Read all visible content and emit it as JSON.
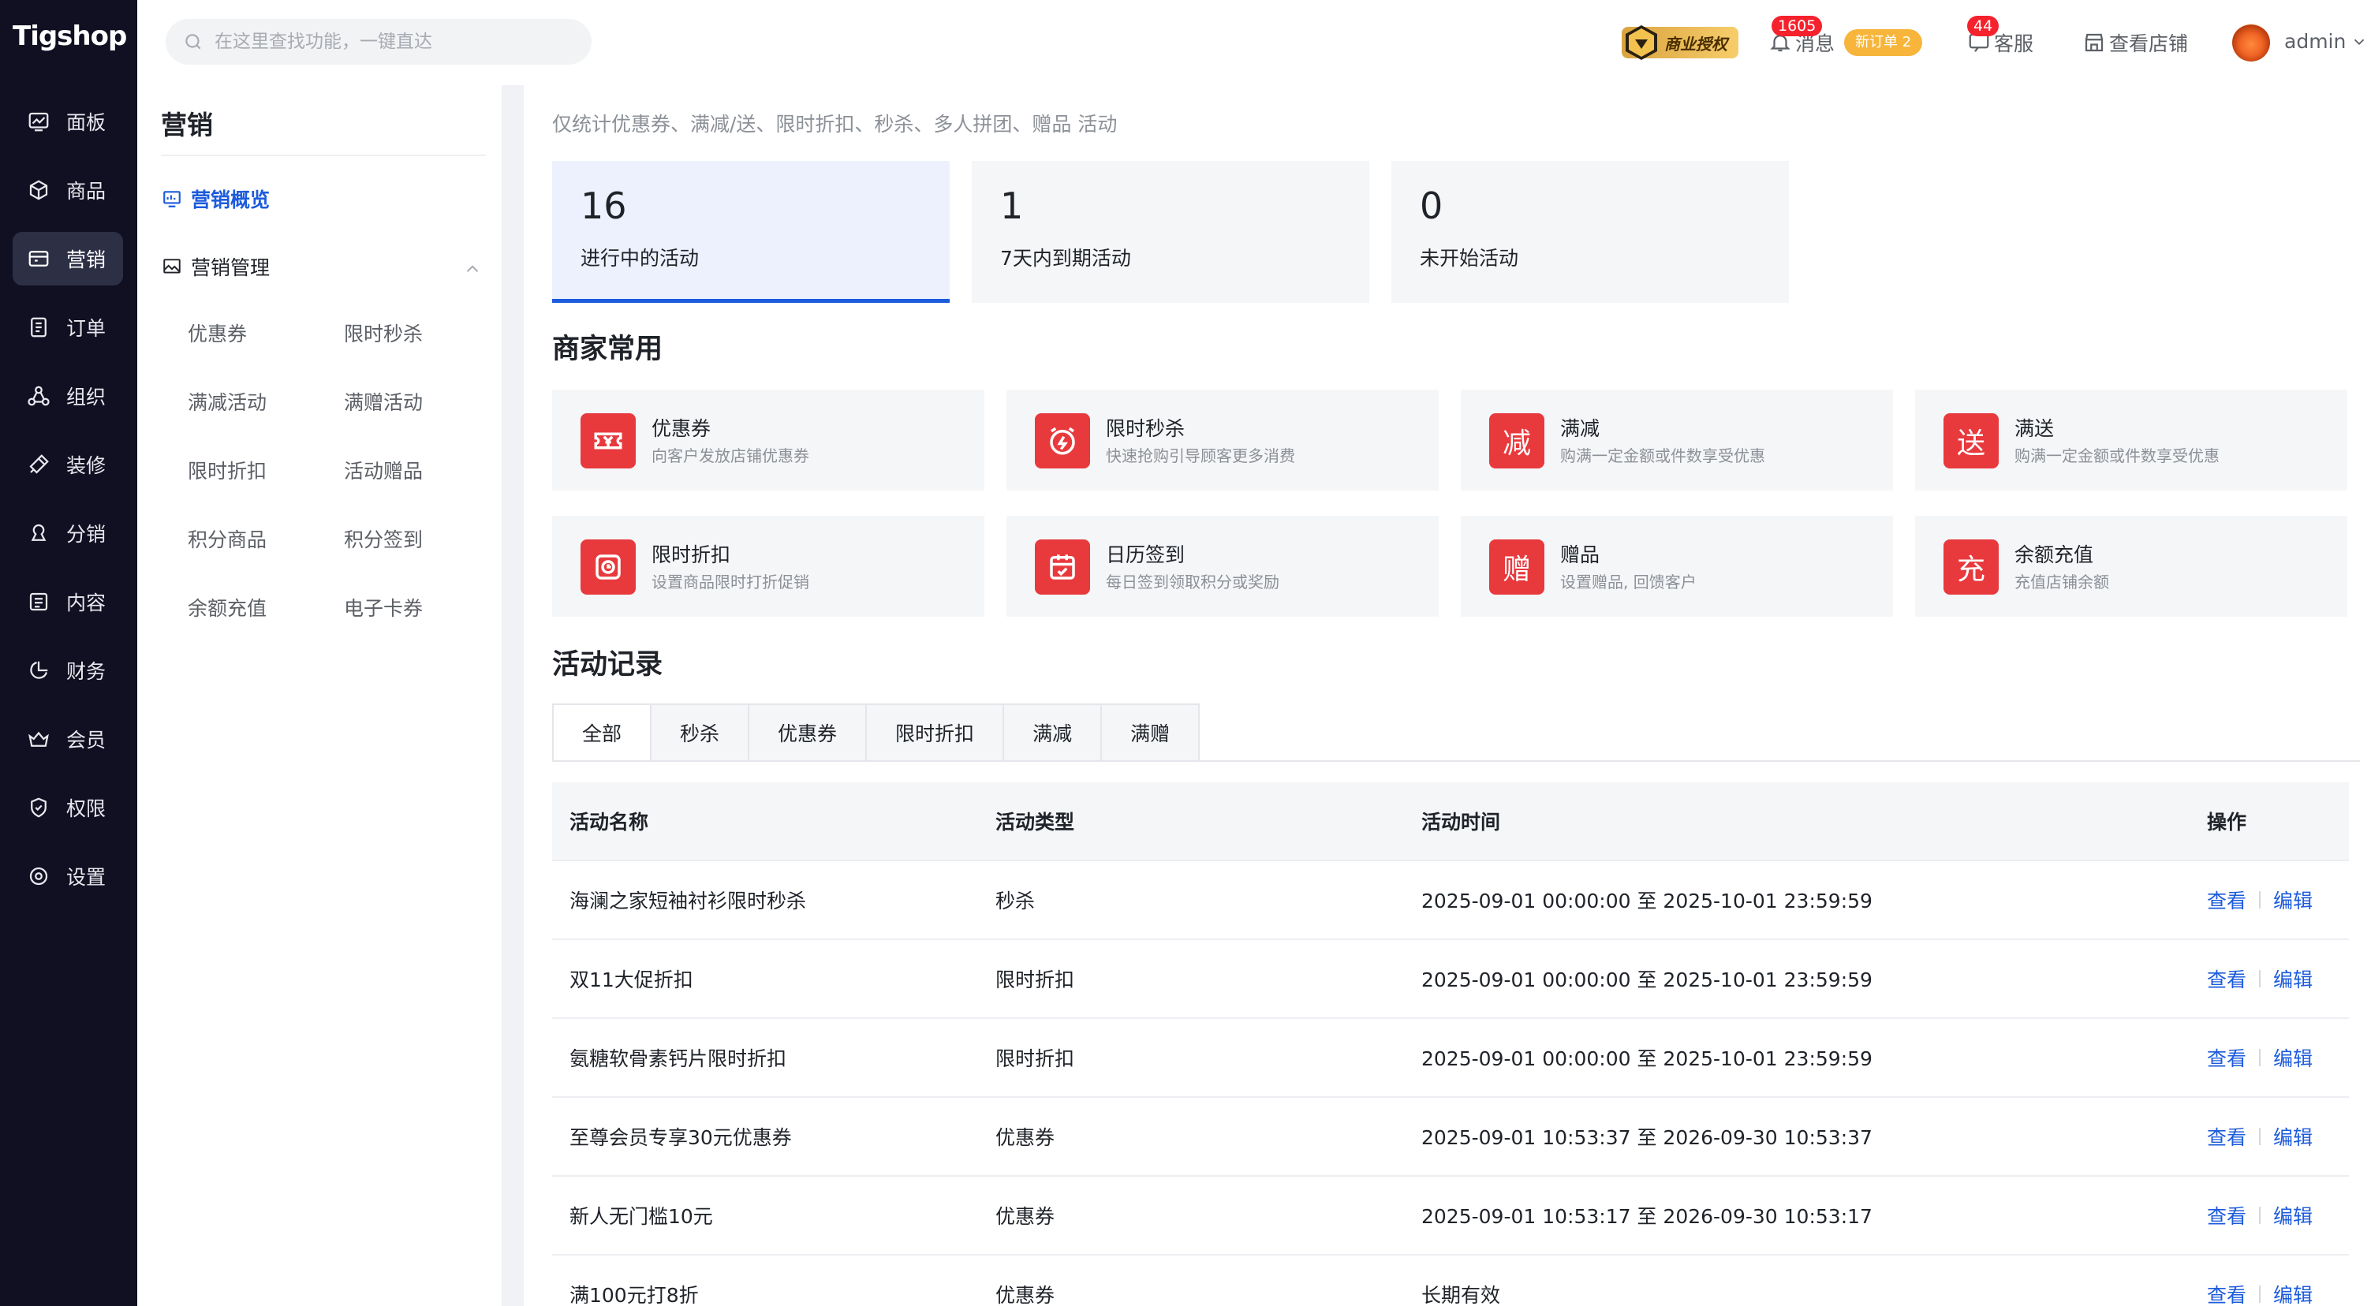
{
  "app": {
    "logo": "Tigshop"
  },
  "sidebar": {
    "items": [
      {
        "label": "面板",
        "icon": "dashboard-icon"
      },
      {
        "label": "商品",
        "icon": "box-icon"
      },
      {
        "label": "营销",
        "icon": "marketing-icon",
        "active": true
      },
      {
        "label": "订单",
        "icon": "order-icon"
      },
      {
        "label": "组织",
        "icon": "org-icon"
      },
      {
        "label": "装修",
        "icon": "decorate-icon"
      },
      {
        "label": "分销",
        "icon": "distribution-icon"
      },
      {
        "label": "内容",
        "icon": "content-icon"
      },
      {
        "label": "财务",
        "icon": "finance-icon"
      },
      {
        "label": "会员",
        "icon": "member-icon"
      },
      {
        "label": "权限",
        "icon": "permission-icon"
      },
      {
        "label": "设置",
        "icon": "settings-icon"
      }
    ]
  },
  "subnav": {
    "title": "营销",
    "overview": "营销概览",
    "management": "营销管理",
    "links": [
      "优惠券",
      "限时秒杀",
      "满减活动",
      "满赠活动",
      "限时折扣",
      "活动赠品",
      "积分商品",
      "积分签到",
      "余额充值",
      "电子卡券"
    ]
  },
  "header": {
    "search_placeholder": "在这里查找功能，一键直达",
    "biz_badge": "商业授权",
    "messages_label": "消息",
    "messages_count": "1605",
    "new_order_label": "新订单 2",
    "service_label": "客服",
    "service_count": "44",
    "shop_label": "查看店铺",
    "user_name": "admin"
  },
  "main": {
    "note": "仅统计优惠券、满减/送、限时折扣、秒杀、多人拼团、赠品 活动",
    "stats": [
      {
        "value": "16",
        "label": "进行中的活动",
        "active": true
      },
      {
        "value": "1",
        "label": "7天内到期活动"
      },
      {
        "value": "0",
        "label": "未开始活动"
      }
    ],
    "common_title": "商家常用",
    "tools": [
      {
        "title": "优惠券",
        "desc": "向客户发放店铺优惠券",
        "glyph": ""
      },
      {
        "title": "限时秒杀",
        "desc": "快速抢购引导顾客更多消费",
        "glyph": ""
      },
      {
        "title": "满减",
        "desc": "购满一定金额或件数享受优惠",
        "glyph": "减"
      },
      {
        "title": "满送",
        "desc": "购满一定金额或件数享受优惠",
        "glyph": "送"
      },
      {
        "title": "限时折扣",
        "desc": "设置商品限时打折促销",
        "glyph": ""
      },
      {
        "title": "日历签到",
        "desc": "每日签到领取积分或奖励",
        "glyph": ""
      },
      {
        "title": "赠品",
        "desc": "设置赠品, 回馈客户",
        "glyph": "赠"
      },
      {
        "title": "余额充值",
        "desc": "充值店铺余额",
        "glyph": "充"
      }
    ],
    "records_title": "活动记录",
    "tabs": [
      "全部",
      "秒杀",
      "优惠券",
      "限时折扣",
      "满减",
      "满赠"
    ],
    "table": {
      "headers": [
        "活动名称",
        "活动类型",
        "活动时间",
        "操作"
      ],
      "view_label": "查看",
      "edit_label": "编辑",
      "rows": [
        {
          "name": "海澜之家短袖衬衫限时秒杀",
          "type": "秒杀",
          "time": "2025-09-01 00:00:00 至 2025-10-01 23:59:59"
        },
        {
          "name": "双11大促折扣",
          "type": "限时折扣",
          "time": "2025-09-01 00:00:00 至 2025-10-01 23:59:59"
        },
        {
          "name": "氨糖软骨素钙片限时折扣",
          "type": "限时折扣",
          "time": "2025-09-01 00:00:00 至 2025-10-01 23:59:59"
        },
        {
          "name": "至尊会员专享30元优惠券",
          "type": "优惠券",
          "time": "2025-09-01 10:53:37 至 2026-09-30 10:53:37"
        },
        {
          "name": "新人无门槛10元",
          "type": "优惠券",
          "time": "2025-09-01 10:53:17 至 2026-09-30 10:53:17"
        },
        {
          "name": "满100元打8折",
          "type": "优惠券",
          "time": "长期有效"
        }
      ]
    }
  }
}
